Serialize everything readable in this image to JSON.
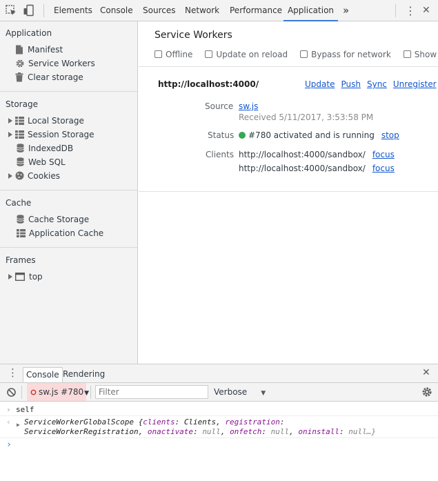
{
  "toolbar": {
    "tabs": [
      "Elements",
      "Console",
      "Sources",
      "Network",
      "Performance",
      "Application"
    ],
    "active_tab": "Application",
    "more_glyph": "»",
    "menu_glyph": "⋮",
    "close_glyph": "✕",
    "accent_color": "#3879d9"
  },
  "sidebar": {
    "application": {
      "title": "Application",
      "items": [
        "Manifest",
        "Service Workers",
        "Clear storage"
      ]
    },
    "storage": {
      "title": "Storage",
      "items": [
        "Local Storage",
        "Session Storage",
        "IndexedDB",
        "Web SQL",
        "Cookies"
      ]
    },
    "cache": {
      "title": "Cache",
      "items": [
        "Cache Storage",
        "Application Cache"
      ]
    },
    "frames": {
      "title": "Frames",
      "items": [
        "top"
      ]
    }
  },
  "service_workers": {
    "title": "Service Workers",
    "options": [
      "Offline",
      "Update on reload",
      "Bypass for network",
      "Show all"
    ],
    "origin": "http://localhost:4000/",
    "actions": [
      "Update",
      "Push",
      "Sync",
      "Unregister"
    ],
    "source_label": "Source",
    "source_file": "sw.js",
    "received": "Received 5/11/2017, 3:53:58 PM",
    "status_label": "Status",
    "status_text": "#780 activated and is running",
    "status_action": "stop",
    "status_color": "#34a853",
    "clients_label": "Clients",
    "clients": [
      {
        "url": "http://localhost:4000/sandbox/",
        "action": "focus"
      },
      {
        "url": "http://localhost:4000/sandbox/",
        "action": "focus"
      }
    ]
  },
  "drawer": {
    "tabs": [
      "Console",
      "Rendering"
    ],
    "active_tab": "Console",
    "context": "sw.js #780",
    "filter_placeholder": "Filter",
    "level": "Verbose"
  },
  "console": {
    "input_echo": "self",
    "output_line1": {
      "type": "ServiceWorkerGlobalScope",
      "open": "{",
      "k1": "clients",
      "v1": "Clients",
      "k2": "registration"
    },
    "output_line2": {
      "v2": "ServiceWorkerRegistration",
      "k3": "onactivate",
      "v3": "null",
      "k4": "onfetch",
      "v4": "null",
      "k5": "oninstall",
      "v5": "null…}"
    },
    "prompt": "›"
  }
}
